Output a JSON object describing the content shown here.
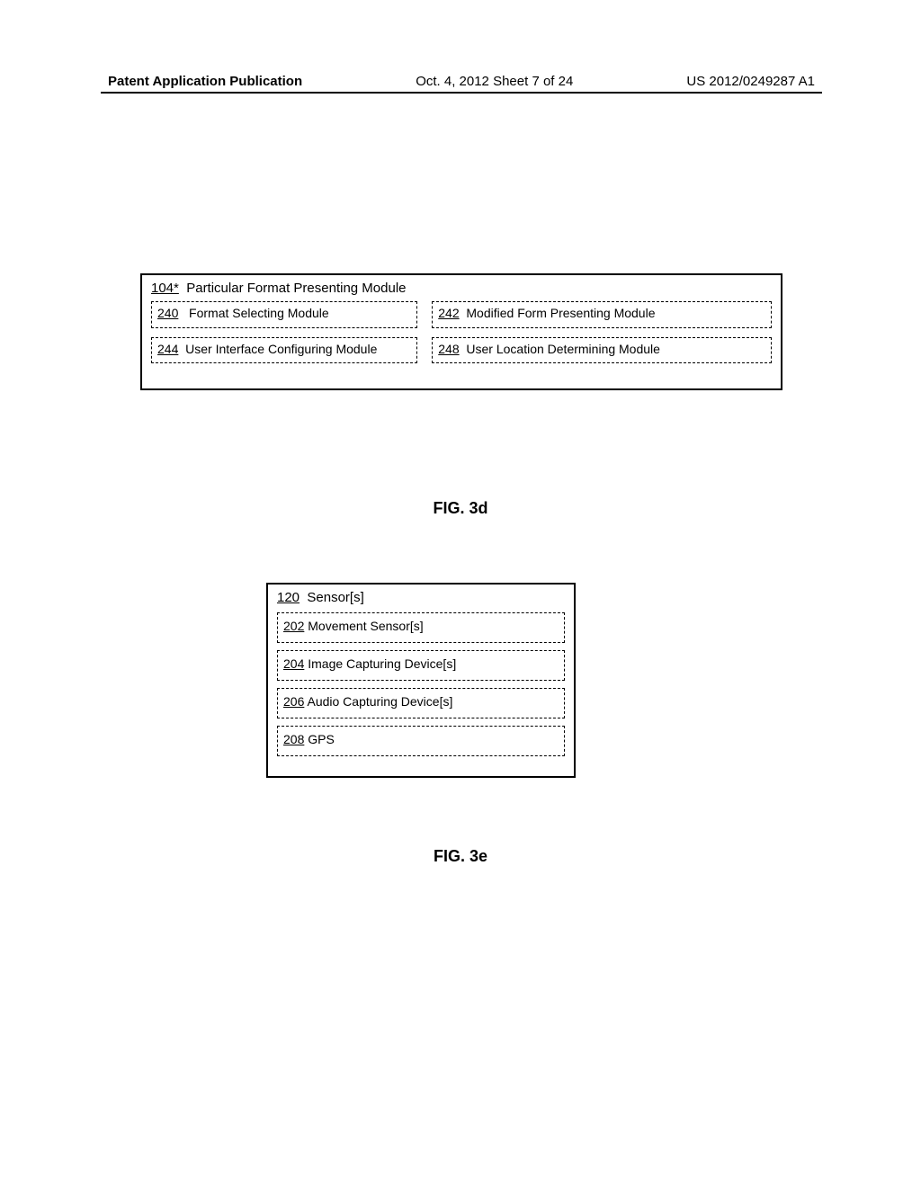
{
  "header": {
    "left": "Patent Application Publication",
    "center": "Oct. 4, 2012  Sheet 7 of 24",
    "right": "US 2012/0249287 A1"
  },
  "fig3d": {
    "main_ref": "104*",
    "main_label": "Particular Format Presenting Module",
    "row1": [
      {
        "ref": "240",
        "label": "Format Selecting Module"
      },
      {
        "ref": "242",
        "label": "Modified Form Presenting Module"
      }
    ],
    "row2": [
      {
        "ref": "244",
        "label": "User Interface Configuring Module"
      },
      {
        "ref": "248",
        "label": "User Location Determining Module"
      }
    ],
    "caption": "FIG. 3d"
  },
  "fig3e": {
    "main_ref": "120",
    "main_label": "Sensor[s]",
    "items": [
      {
        "ref": "202",
        "label": "Movement Sensor[s]"
      },
      {
        "ref": "204",
        "label": "Image Capturing Device[s]"
      },
      {
        "ref": "206",
        "label": "Audio Capturing Device[s]"
      },
      {
        "ref": "208",
        "label": "GPS"
      }
    ],
    "caption": "FIG. 3e"
  }
}
